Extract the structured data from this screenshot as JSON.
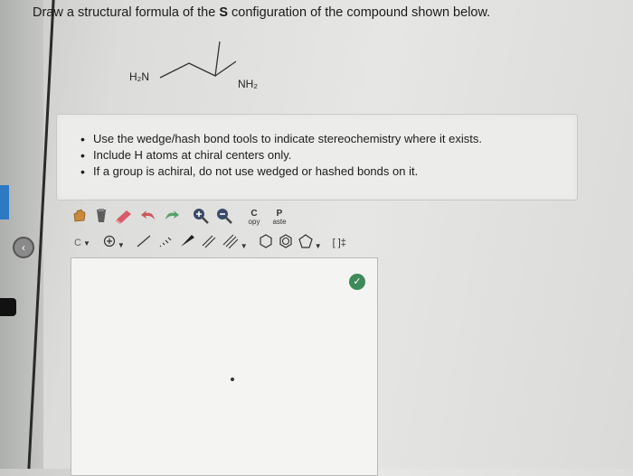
{
  "question": {
    "prefix": "Draw a structural formula of the ",
    "configuration": "S",
    "suffix": " configuration of the compound shown below."
  },
  "molecule": {
    "left_group": "H₂N",
    "right_group": "NH₂"
  },
  "instructions": [
    "Use the wedge/hash bond tools to indicate stereochemistry where it exists.",
    "Include H atoms at chiral centers only.",
    "If a group is achiral, do not use wedged or hashed bonds on it."
  ],
  "toolbar": {
    "copy_letter": "C",
    "copy_label": "opy",
    "paste_letter": "P",
    "paste_label": "aste",
    "carbon_label": "C",
    "charge_label": "[ ]‡"
  },
  "icons": {
    "nav": "chevron-left-icon",
    "status": "check-icon"
  },
  "colors": {
    "accent_blue": "#2d79c4",
    "status_green": "#3f8a5a"
  }
}
